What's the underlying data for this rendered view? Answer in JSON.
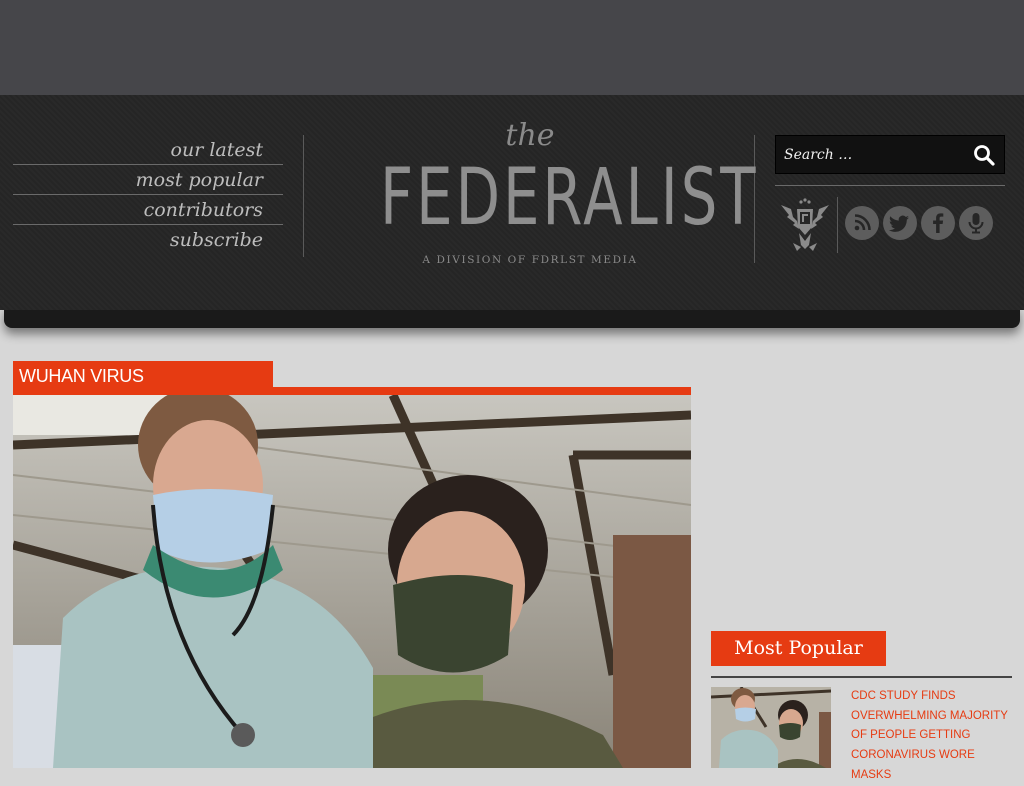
{
  "nav": {
    "items": [
      {
        "label": "our latest"
      },
      {
        "label": "most popular"
      },
      {
        "label": "contributors"
      },
      {
        "label": "subscribe"
      }
    ]
  },
  "logo": {
    "the": "the",
    "name": "FEDERALIST",
    "tagline": "A DIVISION OF FDRLST MEDIA"
  },
  "search": {
    "placeholder": "Search …"
  },
  "social": {
    "icons": [
      "rss-icon",
      "twitter-icon",
      "facebook-icon",
      "podcast-icon"
    ]
  },
  "article": {
    "category": "WUHAN VIRUS"
  },
  "sidebar": {
    "title": "Most Popular",
    "items": [
      {
        "title": "CDC STUDY FINDS OVERWHELMING MAJORITY OF PEOPLE GETTING CORONAVIRUS WORE MASKS"
      }
    ]
  },
  "colors": {
    "accent": "#e63b12",
    "header_bg": "#262626",
    "top_bar": "#46464a",
    "page_bg": "#d7d7d7"
  }
}
